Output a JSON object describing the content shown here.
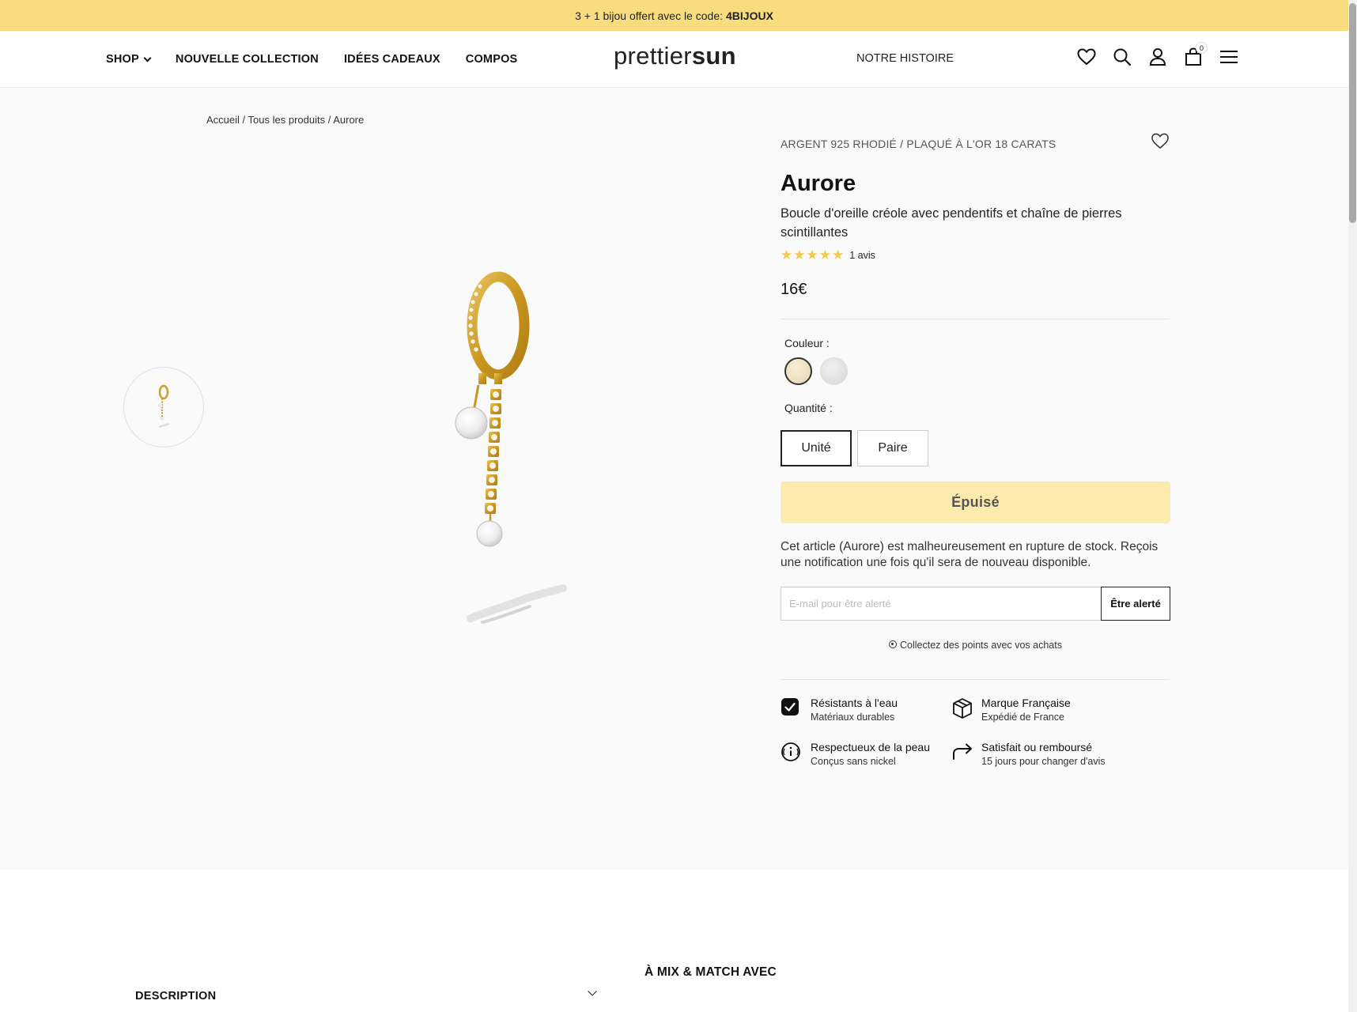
{
  "promo": {
    "text": "3 + 1 bijou offert avec le code:",
    "code": "4BIJOUX"
  },
  "nav": {
    "shop": "SHOP",
    "nouvelle_collection": "NOUVELLE COLLECTION",
    "idees_cadeaux": "IDÉES CADEAUX",
    "compos": "COMPOS",
    "notre_histoire": "NOTRE HISTOIRE"
  },
  "logo": {
    "part1": "prettier",
    "part2": "sun"
  },
  "header_icons": [
    "heart-icon",
    "search-icon",
    "user-icon",
    "cart-icon",
    "menu-icon"
  ],
  "cart_count": "0",
  "breadcrumb": {
    "home": "Accueil",
    "sep": " / ",
    "all": "Tous les produits",
    "current": "Aurore"
  },
  "product": {
    "material": "ARGENT 925 RHODIÉ / PLAQUÉ À L'OR 18 CARATS",
    "name": "Aurore",
    "description": "Boucle d'oreille créole avec pendentifs et chaîne de pierres scintillantes",
    "rating": 5,
    "reviews": "1 avis",
    "price": "16€"
  },
  "options": {
    "color_label": "Couleur :",
    "colors": [
      {
        "name": "gold",
        "hex": "#e9dab8",
        "selected": true
      },
      {
        "name": "silver",
        "hex": "#dedede",
        "selected": false
      }
    ],
    "qty_label": "Quantité :",
    "qty_unit": "Unité",
    "qty_pair": "Paire"
  },
  "soldout_label": "Épuisé",
  "stock_message": "Cet article (Aurore) est malheureusement en rupture de stock. Reçois une notification une fois qu'il sera de nouveau disponible.",
  "alert": {
    "placeholder": "E-mail pour être alerté",
    "button": "Être alerté"
  },
  "points_text": "Collectez des points avec vos achats",
  "features": [
    {
      "title": "Résistants à l'eau",
      "sub": "Matériaux durables",
      "icon": "check-badge-icon"
    },
    {
      "title": "Marque Française",
      "sub": "Expédié de France",
      "icon": "box-icon"
    },
    {
      "title": "Respectueux de la peau",
      "sub": "Conçus sans nickel",
      "icon": "info-circle-icon"
    },
    {
      "title": "Satisfait ou remboursé",
      "sub": "15 jours pour changer d'avis",
      "icon": "return-arrow-icon"
    }
  ],
  "mix_title": "À MIX & MATCH AVEC",
  "description_label": "DESCRIPTION",
  "colors": {
    "promo_bg": "#f8dc7d",
    "soldout_bg": "#fdeaad",
    "star": "#f4c84b",
    "page_bg": "#fafafa"
  }
}
